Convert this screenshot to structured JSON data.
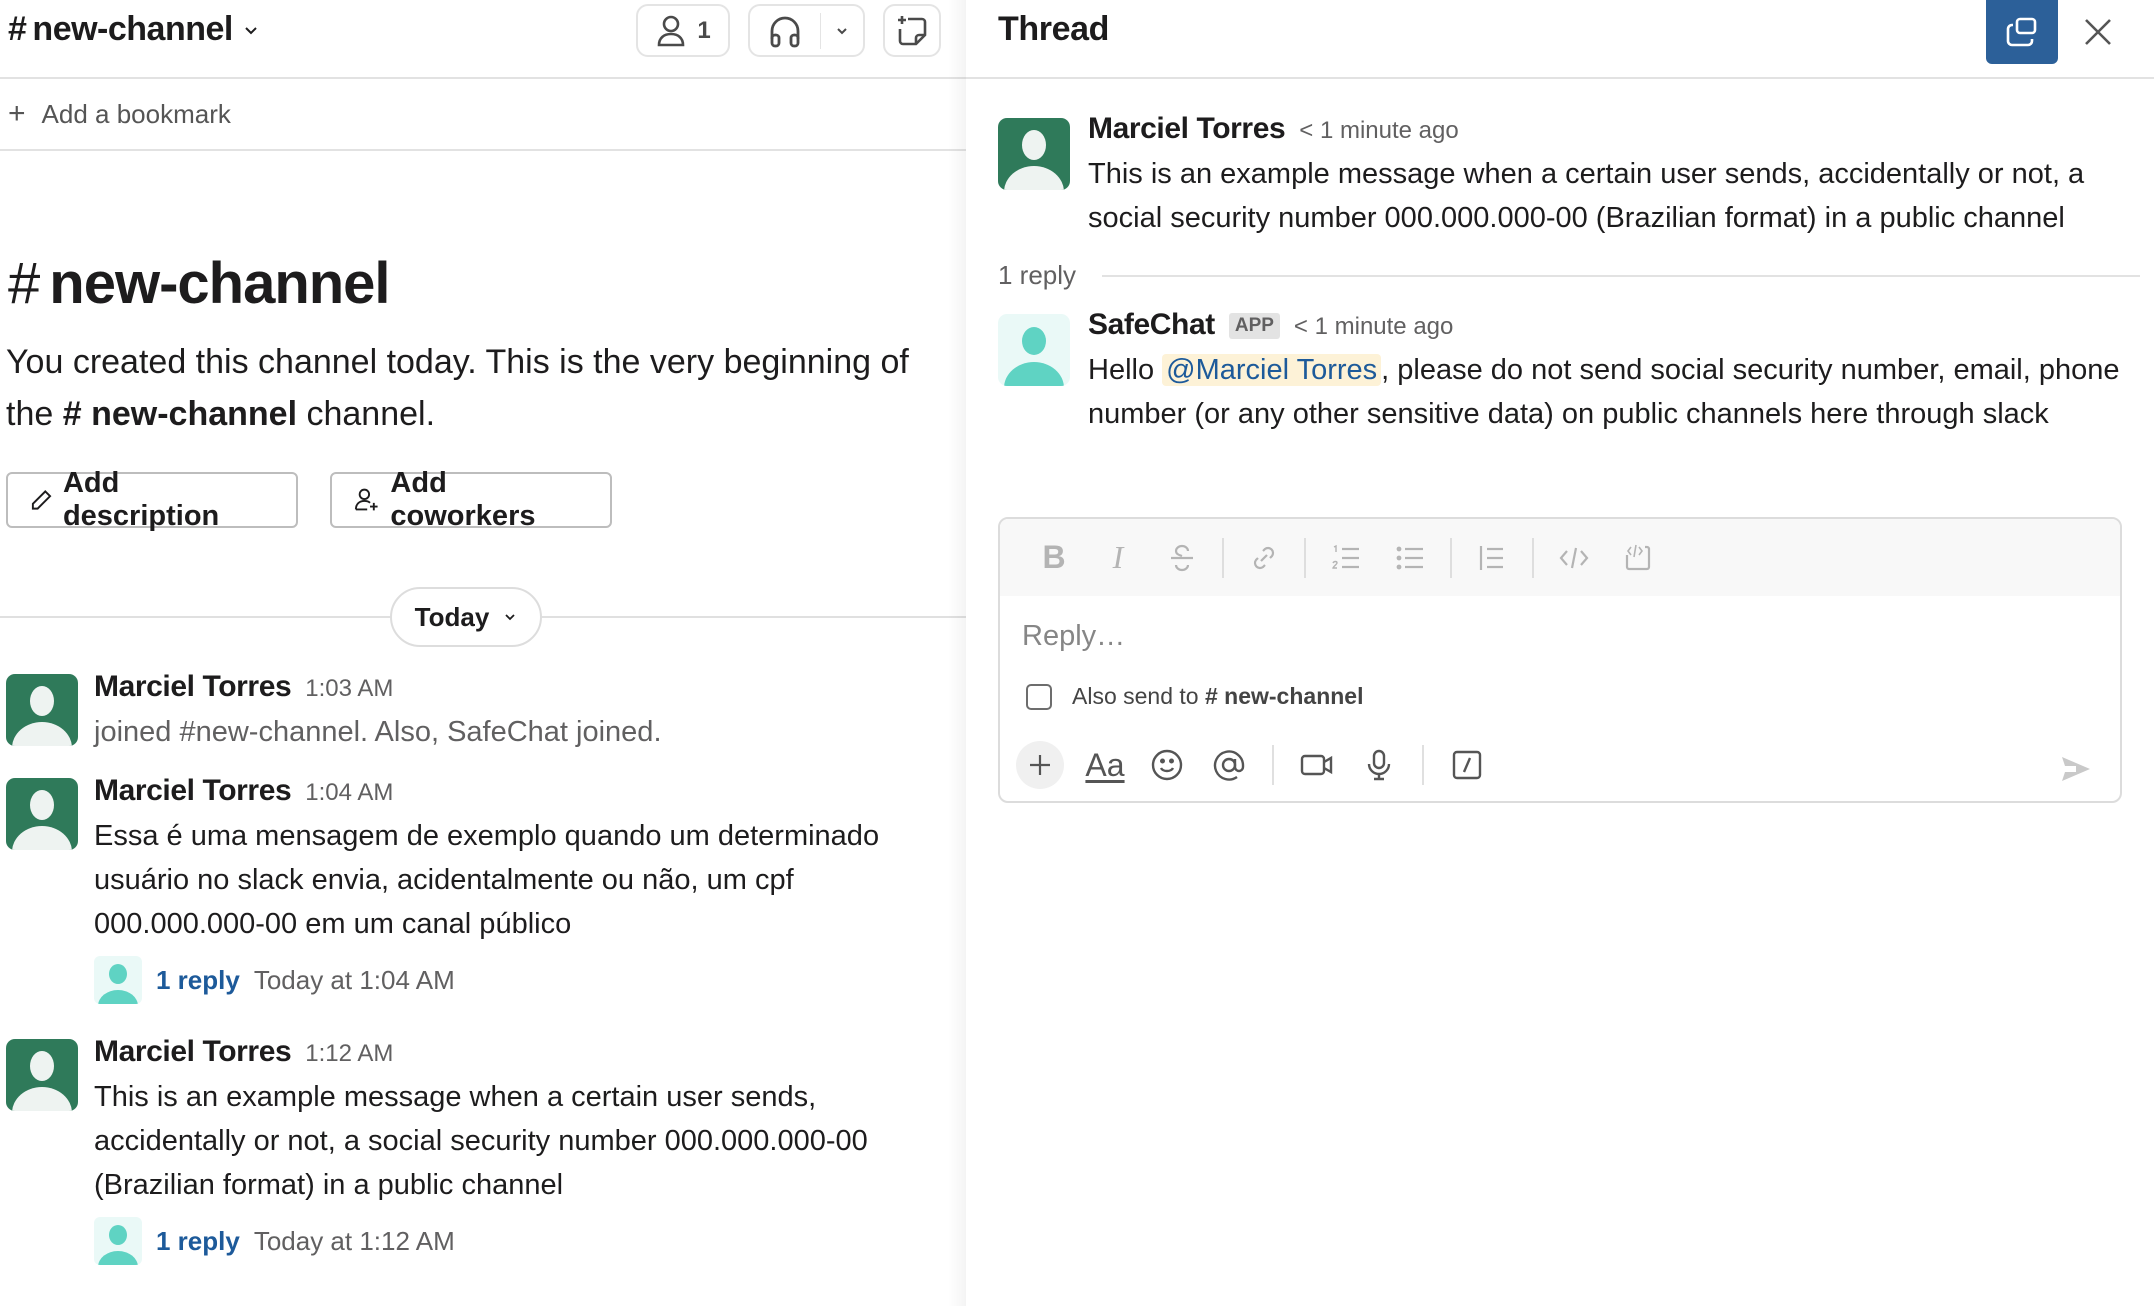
{
  "channel": {
    "name": "new-channel",
    "hash": "#",
    "member_count": "1",
    "bookmark_label": "Add a bookmark",
    "intro": {
      "title": "new-channel",
      "text_before": "You created this channel today. This is the very beginning of the",
      "channel_ref": "new-channel",
      "text_after": "channel."
    },
    "actions": {
      "add_description": "Add description",
      "add_coworkers": "Add coworkers"
    },
    "date_divider": "Today",
    "messages": [
      {
        "author": "Marciel Torres",
        "time": "1:03 AM",
        "text": "joined #new-channel. Also, SafeChat joined.",
        "muted": true
      },
      {
        "author": "Marciel Torres",
        "time": "1:04 AM",
        "text": "Essa é uma mensagem de exemplo quando um determinado usuário no slack envia, acidentalmente ou não, um cpf 000.000.000-00 em um canal público",
        "thread": {
          "reply_label": "1 reply",
          "last_reply": "Today at 1:04 AM"
        }
      },
      {
        "author": "Marciel Torres",
        "time": "1:12 AM",
        "text": "This is an example message when a certain user sends, accidentally or not, a social security number 000.000.000-00 (Brazilian format) in a public channel",
        "thread": {
          "reply_label": "1 reply",
          "last_reply": "Today at 1:12 AM"
        }
      }
    ]
  },
  "thread": {
    "title": "Thread",
    "parent": {
      "author": "Marciel Torres",
      "time": "< 1 minute ago",
      "text": "This is an example message when a certain user sends, accidentally or not, a social security number 000.000.000-00 (Brazilian format) in a public channel"
    },
    "reply_count": "1 reply",
    "replies": [
      {
        "author": "SafeChat",
        "badge": "APP",
        "time": "< 1 minute ago",
        "text_before": "Hello ",
        "mention": "@Marciel Torres",
        "text_after": ", please do not send social security number, email, phone number (or any other sensitive data) on public channels here through slack"
      }
    ],
    "composer": {
      "placeholder": "Reply…",
      "value": "",
      "also_send_label": "Also send to",
      "also_send_channel": "# new-channel",
      "also_send_checked": false,
      "format_bold": "B",
      "format_italic": "I",
      "text_format": "Aa"
    }
  },
  "colors": {
    "user_avatar": "#2f7a5a",
    "app_avatar": "#5fd3c3",
    "link": "#1d5a9a",
    "popout_active": "#2c6099",
    "mention_bg": "#fdf2d7"
  }
}
